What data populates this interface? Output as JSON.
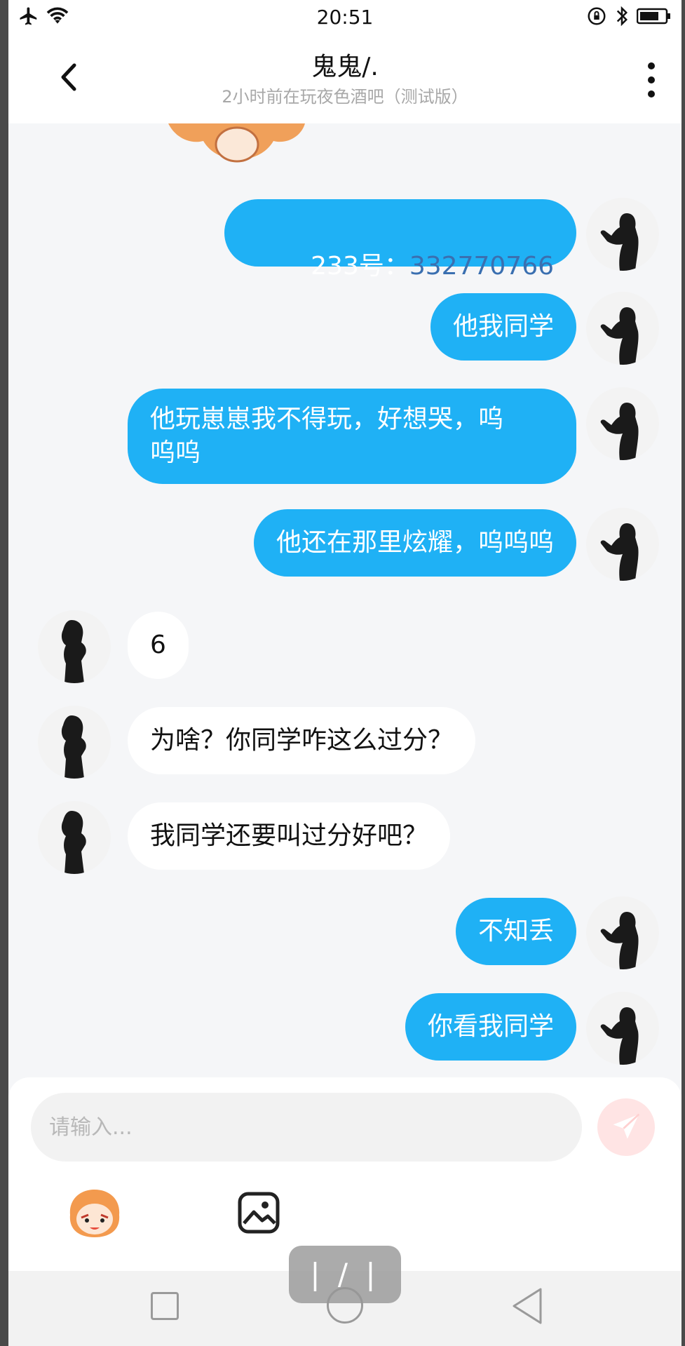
{
  "status_bar": {
    "time": "20:51",
    "left_icons": [
      "airplane-icon",
      "wifi-icon"
    ],
    "right_icons": [
      "rotation-lock-icon",
      "bluetooth-icon",
      "battery-icon"
    ]
  },
  "header": {
    "title": "鬼鬼/.",
    "subtitle": "2小时前在玩夜色酒吧（测试版）"
  },
  "messages": [
    {
      "side": "out",
      "text_plain": "233号：",
      "text_link": "332770766"
    },
    {
      "side": "out",
      "text": "他我同学"
    },
    {
      "side": "out",
      "text": "他玩崽崽我不得玩，好想哭，呜\n呜呜"
    },
    {
      "side": "out",
      "text": "他还在那里炫耀，呜呜呜"
    },
    {
      "side": "in",
      "text": "6"
    },
    {
      "side": "in",
      "text": "为啥？你同学咋这么过分？"
    },
    {
      "side": "in",
      "text": "我同学还要叫过分好吧？"
    },
    {
      "side": "out",
      "text": "不知丢"
    },
    {
      "side": "out",
      "text": "你看我同学"
    }
  ],
  "input": {
    "placeholder": "请输入..."
  },
  "page_indicator": "| / |",
  "colors": {
    "outgoing_bubble": "#1fb1f5",
    "incoming_bubble": "#ffffff",
    "chat_background": "#f5f6f8",
    "link_text": "#3a6fb0"
  }
}
